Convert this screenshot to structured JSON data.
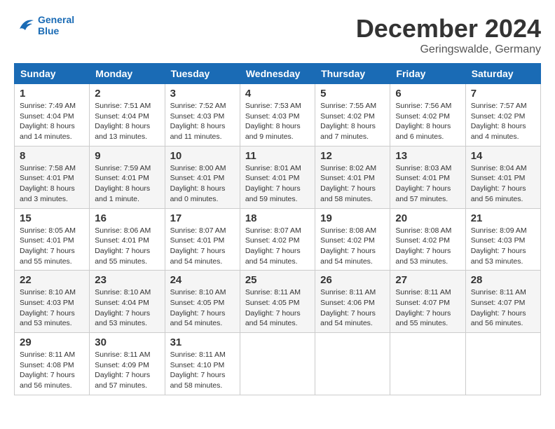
{
  "logo": {
    "line1": "General",
    "line2": "Blue"
  },
  "title": "December 2024",
  "subtitle": "Geringswalde, Germany",
  "days_of_week": [
    "Sunday",
    "Monday",
    "Tuesday",
    "Wednesday",
    "Thursday",
    "Friday",
    "Saturday"
  ],
  "weeks": [
    [
      {
        "day": "1",
        "sunrise": "7:49 AM",
        "sunset": "4:04 PM",
        "daylight": "8 hours and 14 minutes."
      },
      {
        "day": "2",
        "sunrise": "7:51 AM",
        "sunset": "4:04 PM",
        "daylight": "8 hours and 13 minutes."
      },
      {
        "day": "3",
        "sunrise": "7:52 AM",
        "sunset": "4:03 PM",
        "daylight": "8 hours and 11 minutes."
      },
      {
        "day": "4",
        "sunrise": "7:53 AM",
        "sunset": "4:03 PM",
        "daylight": "8 hours and 9 minutes."
      },
      {
        "day": "5",
        "sunrise": "7:55 AM",
        "sunset": "4:02 PM",
        "daylight": "8 hours and 7 minutes."
      },
      {
        "day": "6",
        "sunrise": "7:56 AM",
        "sunset": "4:02 PM",
        "daylight": "8 hours and 6 minutes."
      },
      {
        "day": "7",
        "sunrise": "7:57 AM",
        "sunset": "4:02 PM",
        "daylight": "8 hours and 4 minutes."
      }
    ],
    [
      {
        "day": "8",
        "sunrise": "7:58 AM",
        "sunset": "4:01 PM",
        "daylight": "8 hours and 3 minutes."
      },
      {
        "day": "9",
        "sunrise": "7:59 AM",
        "sunset": "4:01 PM",
        "daylight": "8 hours and 1 minute."
      },
      {
        "day": "10",
        "sunrise": "8:00 AM",
        "sunset": "4:01 PM",
        "daylight": "8 hours and 0 minutes."
      },
      {
        "day": "11",
        "sunrise": "8:01 AM",
        "sunset": "4:01 PM",
        "daylight": "7 hours and 59 minutes."
      },
      {
        "day": "12",
        "sunrise": "8:02 AM",
        "sunset": "4:01 PM",
        "daylight": "7 hours and 58 minutes."
      },
      {
        "day": "13",
        "sunrise": "8:03 AM",
        "sunset": "4:01 PM",
        "daylight": "7 hours and 57 minutes."
      },
      {
        "day": "14",
        "sunrise": "8:04 AM",
        "sunset": "4:01 PM",
        "daylight": "7 hours and 56 minutes."
      }
    ],
    [
      {
        "day": "15",
        "sunrise": "8:05 AM",
        "sunset": "4:01 PM",
        "daylight": "7 hours and 55 minutes."
      },
      {
        "day": "16",
        "sunrise": "8:06 AM",
        "sunset": "4:01 PM",
        "daylight": "7 hours and 55 minutes."
      },
      {
        "day": "17",
        "sunrise": "8:07 AM",
        "sunset": "4:01 PM",
        "daylight": "7 hours and 54 minutes."
      },
      {
        "day": "18",
        "sunrise": "8:07 AM",
        "sunset": "4:02 PM",
        "daylight": "7 hours and 54 minutes."
      },
      {
        "day": "19",
        "sunrise": "8:08 AM",
        "sunset": "4:02 PM",
        "daylight": "7 hours and 54 minutes."
      },
      {
        "day": "20",
        "sunrise": "8:08 AM",
        "sunset": "4:02 PM",
        "daylight": "7 hours and 53 minutes."
      },
      {
        "day": "21",
        "sunrise": "8:09 AM",
        "sunset": "4:03 PM",
        "daylight": "7 hours and 53 minutes."
      }
    ],
    [
      {
        "day": "22",
        "sunrise": "8:10 AM",
        "sunset": "4:03 PM",
        "daylight": "7 hours and 53 minutes."
      },
      {
        "day": "23",
        "sunrise": "8:10 AM",
        "sunset": "4:04 PM",
        "daylight": "7 hours and 53 minutes."
      },
      {
        "day": "24",
        "sunrise": "8:10 AM",
        "sunset": "4:05 PM",
        "daylight": "7 hours and 54 minutes."
      },
      {
        "day": "25",
        "sunrise": "8:11 AM",
        "sunset": "4:05 PM",
        "daylight": "7 hours and 54 minutes."
      },
      {
        "day": "26",
        "sunrise": "8:11 AM",
        "sunset": "4:06 PM",
        "daylight": "7 hours and 54 minutes."
      },
      {
        "day": "27",
        "sunrise": "8:11 AM",
        "sunset": "4:07 PM",
        "daylight": "7 hours and 55 minutes."
      },
      {
        "day": "28",
        "sunrise": "8:11 AM",
        "sunset": "4:07 PM",
        "daylight": "7 hours and 56 minutes."
      }
    ],
    [
      {
        "day": "29",
        "sunrise": "8:11 AM",
        "sunset": "4:08 PM",
        "daylight": "7 hours and 56 minutes."
      },
      {
        "day": "30",
        "sunrise": "8:11 AM",
        "sunset": "4:09 PM",
        "daylight": "7 hours and 57 minutes."
      },
      {
        "day": "31",
        "sunrise": "8:11 AM",
        "sunset": "4:10 PM",
        "daylight": "7 hours and 58 minutes."
      },
      null,
      null,
      null,
      null
    ]
  ]
}
